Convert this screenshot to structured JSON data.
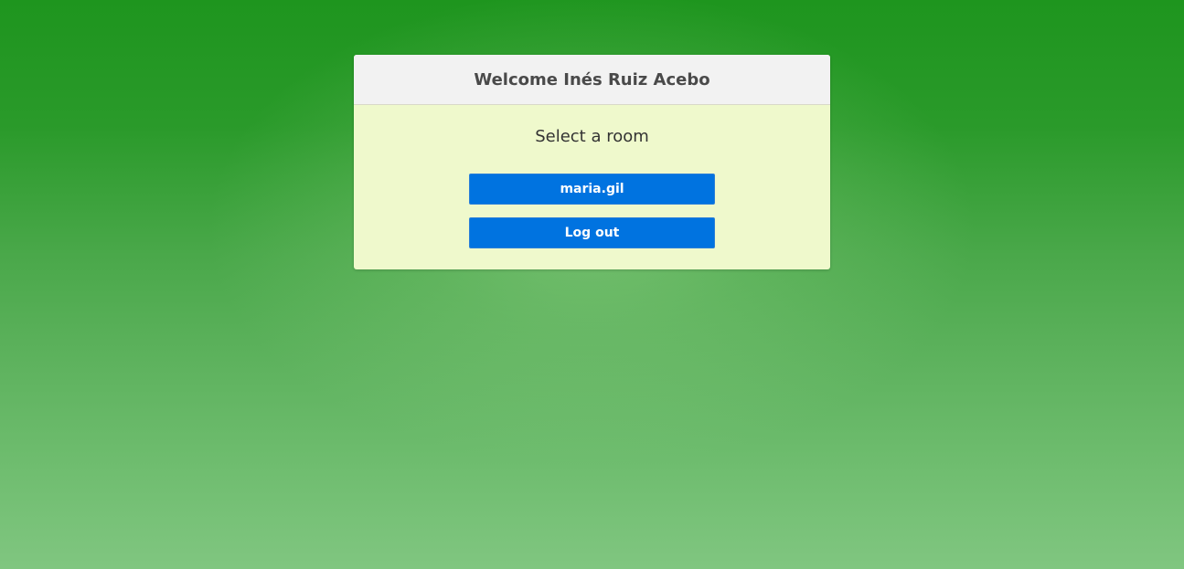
{
  "panel": {
    "title": "Welcome Inés Ruiz Acebo",
    "subtitle": "Select a room",
    "rooms": [
      {
        "label": "maria.gil"
      }
    ],
    "logout_label": "Log out"
  },
  "colors": {
    "background_top": "#1e951e",
    "background_bottom": "#80c680",
    "panel_header": "#f2f2f2",
    "panel_body": "#eff9cc",
    "button": "#0073e0",
    "button_text": "#ffffff",
    "title_text": "#4a4a4a"
  }
}
